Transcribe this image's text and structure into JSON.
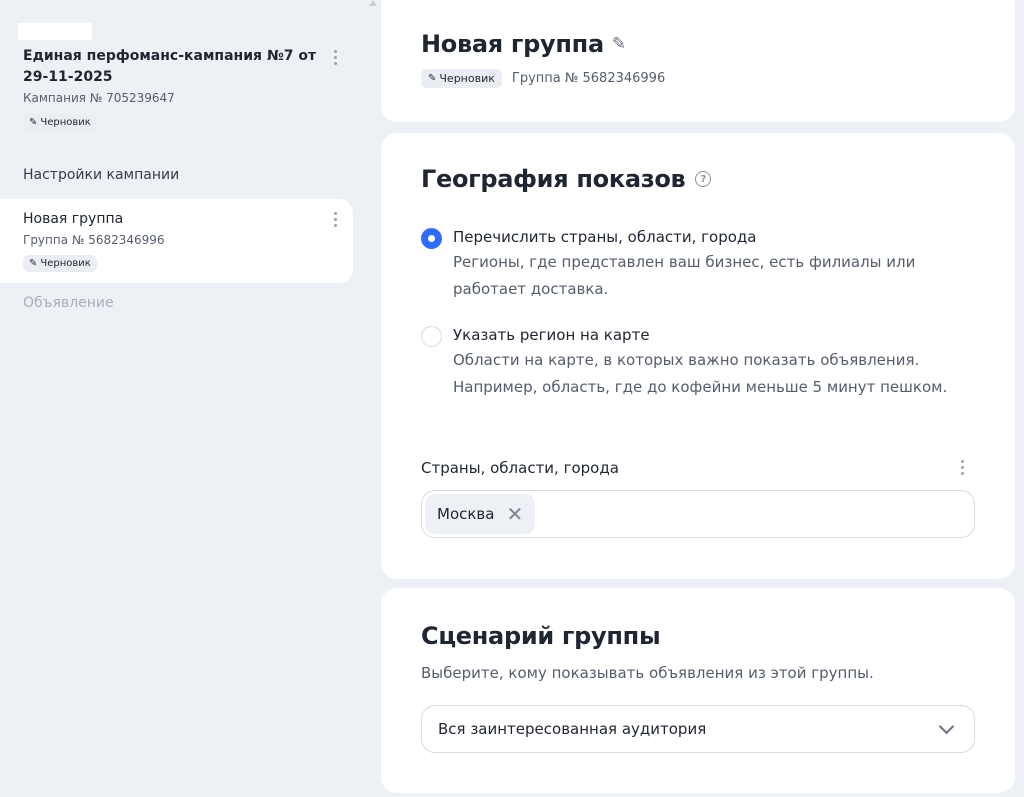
{
  "sidebar": {
    "campaign": {
      "title": "Единая перфоманс-кампания №7 от 29-11-2025",
      "number": "Кампания № 705239647",
      "status": "Черновик"
    },
    "settings_link": "Настройки кампании",
    "group": {
      "title": "Новая группа",
      "number": "Группа № 5682346996",
      "status": "Черновик"
    },
    "ad_link": "Объявление"
  },
  "header_card": {
    "title": "Новая группа",
    "status": "Черновик",
    "group_number": "Группа № 5682346996"
  },
  "geo_card": {
    "title": "География показов",
    "help_icon": "?",
    "options": [
      {
        "label": "Перечислить страны, области, города",
        "description": "Регионы, где представлен ваш бизнес, есть филиалы или работает доставка.",
        "selected": true
      },
      {
        "label": "Указать регион на карте",
        "description": "Области на карте, в которых важно показать объявления. Например, область, где до кофейни меньше 5 минут пешком.",
        "selected": false
      }
    ],
    "regions_label": "Страны, области, города",
    "regions": [
      "Москва"
    ]
  },
  "scenario_card": {
    "title": "Сценарий группы",
    "description": "Выберите, кому показывать объявления из этой группы.",
    "selected_value": "Вся заинтересованная аудитория"
  },
  "colors": {
    "accent": "#2f6bff",
    "page_bg": "#edf0f5",
    "card_bg": "#ffffff",
    "muted_text": "#555d6c"
  }
}
